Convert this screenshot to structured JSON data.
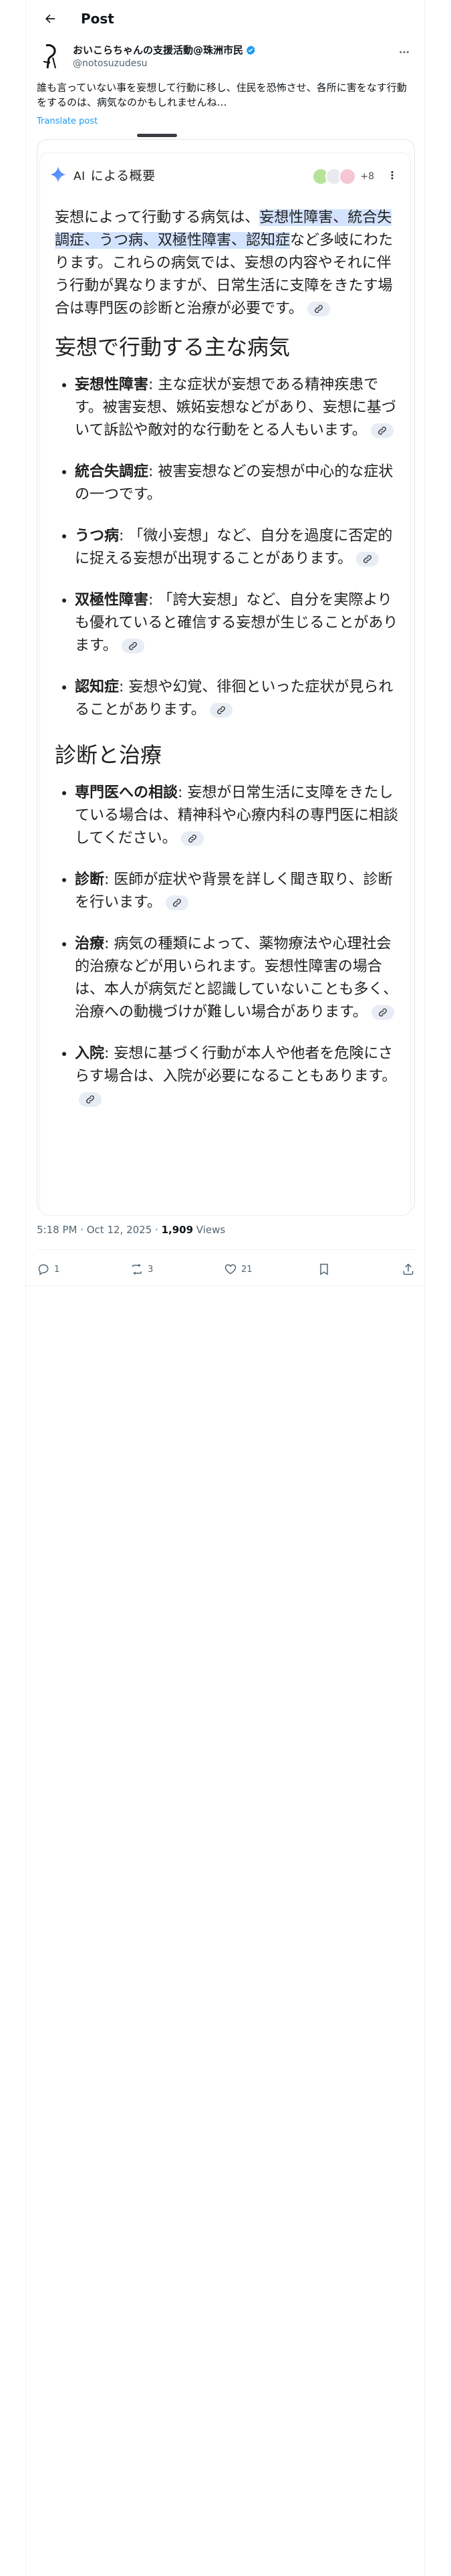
{
  "header": {
    "title": "Post"
  },
  "author": {
    "name": "おいこらちゃんの支援活動@珠洲市民",
    "handle": "@notosuzudesu"
  },
  "tweet": {
    "text": "誰も言っていない事を妄想して行動に移し、住民を恐怖させ、各所に害をなす行動をするのは、病気なのかもしれませんね…",
    "translate": "Translate post"
  },
  "ai_overview": {
    "label_ai": "AI",
    "label_text": "による概要",
    "sources_more": "+8",
    "intro": {
      "t1": "妄想によって行動する病気は、",
      "t2": "妄想性障害、統合失調症、うつ病、双極性障害、認知症",
      "t3": "など多岐にわたります。これらの病気では、妄想の内容やそれに伴う行動が異なりますが、日常生活に支障をきたす場合は専門医の診断と治療が必要です。"
    },
    "section1": {
      "title": "妄想で行動する主な病気",
      "items": [
        {
          "term": "妄想性障害",
          "desc": ": 主な症状が妄想である精神疾患です。被害妄想、嫉妬妄想などがあり、妄想に基づいて訴訟や敵対的な行動をとる人もいます。"
        },
        {
          "term": "統合失調症",
          "desc": ": 被害妄想などの妄想が中心的な症状の一つです。"
        },
        {
          "term": "うつ病",
          "desc": ": 「微小妄想」など、自分を過度に否定的に捉える妄想が出現することがあります。"
        },
        {
          "term": "双極性障害",
          "desc": ": 「誇大妄想」など、自分を実際よりも優れていると確信する妄想が生じることがあります。"
        },
        {
          "term": "認知症",
          "desc": ": 妄想や幻覚、徘徊といった症状が見られることがあります。"
        }
      ]
    },
    "section2": {
      "title": "診断と治療",
      "items": [
        {
          "term": "専門医への相談",
          "desc": ": 妄想が日常生活に支障をきたしている場合は、精神科や心療内科の専門医に相談してください。"
        },
        {
          "term": "診断",
          "desc": ": 医師が症状や背景を詳しく聞き取り、診断を行います。"
        },
        {
          "term": "治療",
          "desc": ": 病気の種類によって、薬物療法や心理社会的治療などが用いられます。妄想性障害の場合は、本人が病気だと認識していないことも多く、治療への動機づけが難しい場合があります。"
        },
        {
          "term": "入院",
          "desc": ": 妄想に基づく行動が本人や他者を危険にさらす場合は、入院が必要になることもあります。"
        }
      ]
    }
  },
  "meta": {
    "time": "5:18 PM · Oct 12, 2025 · ",
    "views": "1,909",
    "views_label": " Views"
  },
  "actions": {
    "replies": "1",
    "reposts": "3",
    "likes": "21"
  },
  "colors": {
    "accent": "#1d9bf0",
    "highlight": "#d3e3fd",
    "verified": "#1d9bf0"
  }
}
